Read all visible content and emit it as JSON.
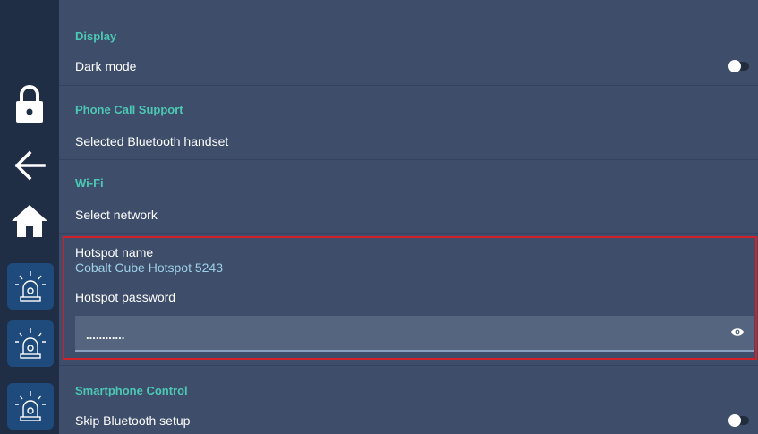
{
  "colors": {
    "sidebar_bg": "#1f2d45",
    "main_bg": "#3d4d6a",
    "section_heading": "#4dc8b4",
    "highlight_border": "#d0202a",
    "siren_button_bg": "#1e4a7c"
  },
  "sidebar": {
    "icons": [
      "lock-icon",
      "back-arrow-icon",
      "home-icon",
      "siren-icon",
      "siren-icon",
      "siren-icon"
    ]
  },
  "display": {
    "heading": "Display",
    "dark_mode_label": "Dark mode",
    "dark_mode_on": false
  },
  "phone": {
    "heading": "Phone Call Support",
    "handset_label": "Selected Bluetooth handset"
  },
  "wifi": {
    "heading": "Wi-Fi",
    "select_network_label": "Select network",
    "hotspot_name_label": "Hotspot name",
    "hotspot_name_value": "Cobalt Cube Hotspot 5243",
    "hotspot_password_label": "Hotspot password",
    "hotspot_password_value": "............"
  },
  "smartphone": {
    "heading": "Smartphone Control",
    "skip_bluetooth_label": "Skip Bluetooth setup",
    "skip_bluetooth_on": false
  }
}
